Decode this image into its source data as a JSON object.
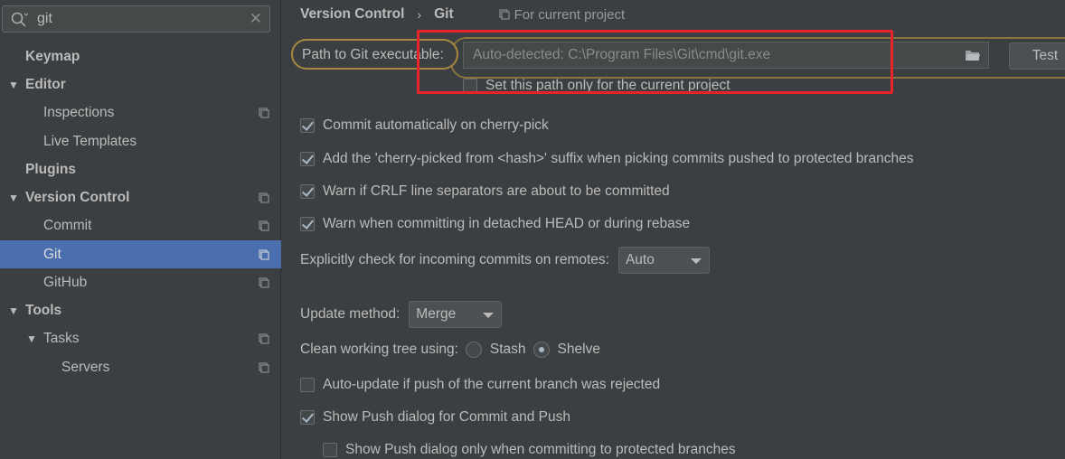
{
  "search": {
    "value": "git"
  },
  "sidebar": {
    "items": [
      {
        "label": "Keymap"
      },
      {
        "label": "Editor"
      },
      {
        "label": "Inspections"
      },
      {
        "label": "Live Templates"
      },
      {
        "label": "Plugins"
      },
      {
        "label": "Version Control"
      },
      {
        "label": "Commit"
      },
      {
        "label": "Git"
      },
      {
        "label": "GitHub"
      },
      {
        "label": "Tools"
      },
      {
        "label": "Tasks"
      },
      {
        "label": "Servers"
      }
    ]
  },
  "breadcrumb": {
    "parent": "Version Control",
    "current": "Git",
    "scope": "For current project"
  },
  "path": {
    "label": "Path to Git executable:",
    "placeholder": "Auto-detected: C:\\Program Files\\Git\\cmd\\git.exe",
    "test_label": "Test",
    "project_only_label": "Set this path only for the current project"
  },
  "options": {
    "cherry_pick": "Commit automatically on cherry-pick",
    "cherry_suffix": "Add the 'cherry-picked from <hash>' suffix when picking commits pushed to protected branches",
    "crlf": "Warn if CRLF line separators are about to be committed",
    "detached": "Warn when committing in detached HEAD or during rebase",
    "incoming_label": "Explicitly check for incoming commits on remotes:",
    "incoming_value": "Auto",
    "update_label": "Update method:",
    "update_value": "Merge",
    "clean_label": "Clean working tree using:",
    "stash": "Stash",
    "shelve": "Shelve",
    "auto_update": "Auto-update if push of the current branch was rejected",
    "show_push": "Show Push dialog for Commit and Push",
    "show_push_protected": "Show Push dialog only when committing to protected branches"
  }
}
